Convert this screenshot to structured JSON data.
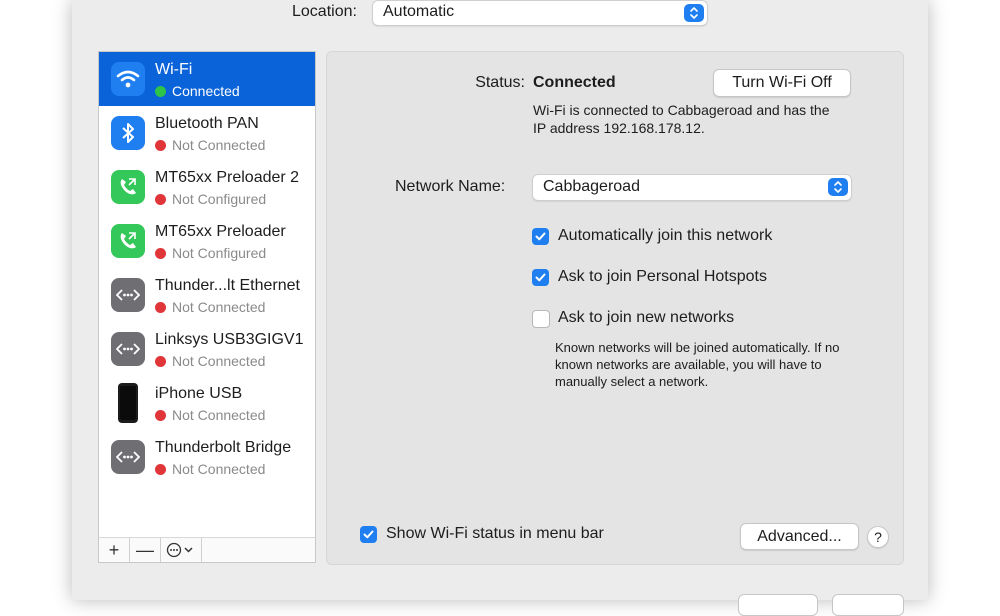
{
  "location": {
    "label": "Location:",
    "value": "Automatic"
  },
  "services": [
    {
      "name": "Wi-Fi",
      "status": "Connected",
      "status_color": "#2ec449",
      "icon": "wifi-icon",
      "icon_bg": "#1f7ff0",
      "selected": true
    },
    {
      "name": "Bluetooth PAN",
      "status": "Not Connected",
      "status_color": "#e0363a",
      "icon": "bluetooth-icon",
      "icon_bg": "#1f7ff0",
      "selected": false
    },
    {
      "name": "MT65xx Preloader 2",
      "status": "Not Configured",
      "status_color": "#e0363a",
      "icon": "phone-icon",
      "icon_bg": "#34c759",
      "selected": false
    },
    {
      "name": "MT65xx Preloader",
      "status": "Not Configured",
      "status_color": "#e0363a",
      "icon": "phone-icon",
      "icon_bg": "#34c759",
      "selected": false
    },
    {
      "name": "Thunder...lt Ethernet",
      "status": "Not Connected",
      "status_color": "#e0363a",
      "icon": "ethernet-icon",
      "icon_bg": "#6e6e73",
      "selected": false
    },
    {
      "name": "Linksys USB3GIGV1",
      "status": "Not Connected",
      "status_color": "#e0363a",
      "icon": "ethernet-icon",
      "icon_bg": "#6e6e73",
      "selected": false
    },
    {
      "name": "iPhone USB",
      "status": "Not Connected",
      "status_color": "#e0363a",
      "icon": "iphone-icon",
      "icon_bg": "#ffffff",
      "selected": false
    },
    {
      "name": "Thunderbolt Bridge",
      "status": "Not Connected",
      "status_color": "#e0363a",
      "icon": "ethernet-icon",
      "icon_bg": "#6e6e73",
      "selected": false
    }
  ],
  "sidebar_buttons": {
    "add": "+",
    "remove": "—"
  },
  "detail": {
    "status_label": "Status:",
    "status_value": "Connected",
    "status_description": "Wi-Fi is connected to Cabbageroad and has the IP address 192.168.178.12.",
    "turn_off_button": "Turn Wi-Fi Off",
    "network_name_label": "Network Name:",
    "network_name_value": "Cabbageroad",
    "options": [
      {
        "label": "Automatically join this network",
        "checked": true
      },
      {
        "label": "Ask to join Personal Hotspots",
        "checked": true
      },
      {
        "label": "Ask to join new networks",
        "checked": false
      }
    ],
    "note": "Known networks will be joined automatically. If no known networks are available, you will have to manually select a network.",
    "show_status_label": "Show Wi-Fi status in menu bar",
    "show_status_checked": true,
    "advanced_button": "Advanced...",
    "help_button": "?"
  },
  "colors": {
    "accent": "#1f7ff0",
    "selection": "#0a63d8",
    "connected": "#2ec449",
    "not_connected": "#e0363a"
  }
}
